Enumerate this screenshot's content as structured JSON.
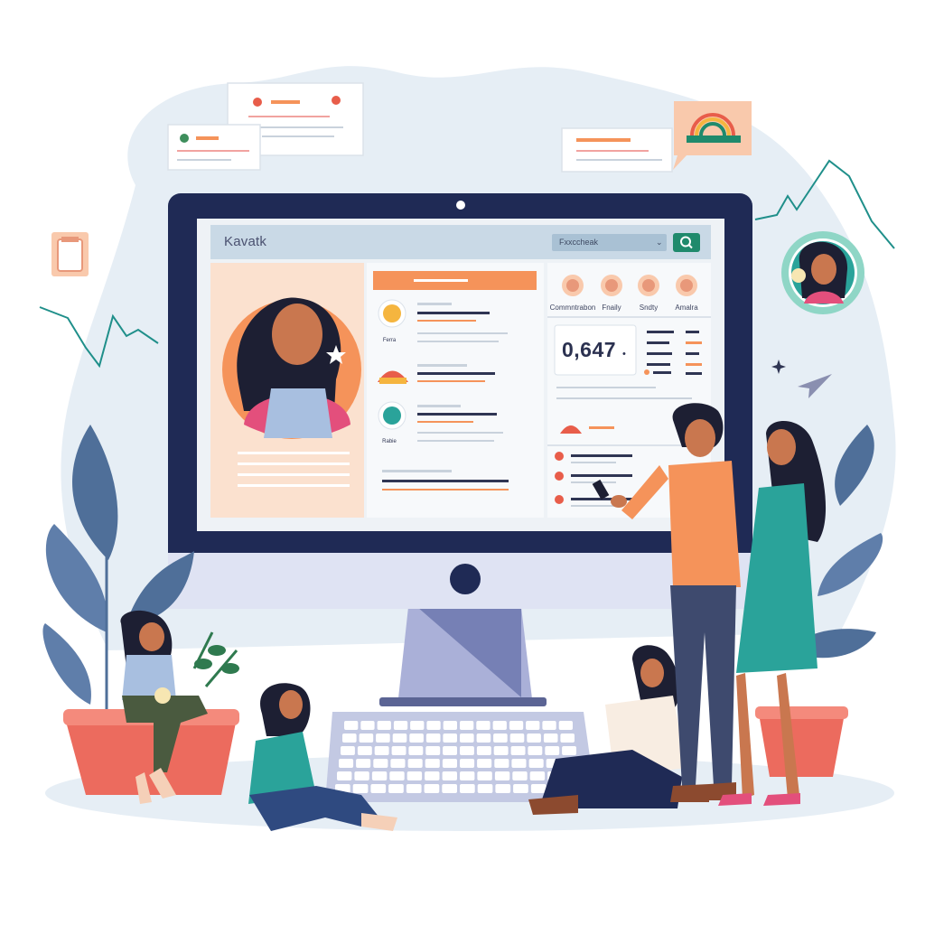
{
  "app": {
    "title": "Kavatk",
    "search_value": "Fxxccheak",
    "search_icon": "search-icon"
  },
  "categories": [
    {
      "label": "Commntrabon",
      "icon": "shirt-icon"
    },
    {
      "label": "Fnaily",
      "icon": "clock-icon"
    },
    {
      "label": "Sndty",
      "icon": "flower-icon"
    },
    {
      "label": "Amalra",
      "icon": "bird-icon"
    }
  ],
  "stats": {
    "value": "0,647",
    "value_suffix": "•"
  },
  "feed": {
    "item_captions": [
      "Ferra",
      "Rabie"
    ]
  },
  "colors": {
    "screen_frame": "#1f2a55",
    "accent_orange": "#f5935a",
    "accent_green": "#1f8a6c",
    "teal": "#2aa39a",
    "background_blob": "#e6eef5"
  }
}
